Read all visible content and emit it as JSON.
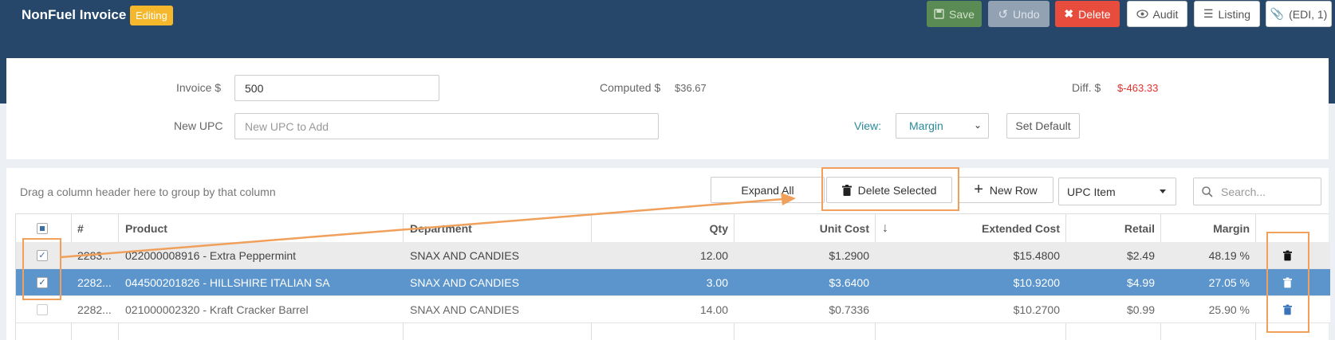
{
  "header": {
    "title": "NonFuel Invoice",
    "badge": "Editing",
    "buttons": {
      "save": "Save",
      "undo": "Undo",
      "delete": "Delete",
      "audit": "Audit",
      "listing": "Listing",
      "edi": "(EDI, 1)"
    }
  },
  "form": {
    "invoice_label": "Invoice $",
    "invoice_value": "500",
    "computed_label": "Computed $",
    "computed_value": "$36.67",
    "diff_label": "Diff. $",
    "diff_value": "$-463.33",
    "new_upc_label": "New UPC",
    "new_upc_placeholder": "New UPC to Add",
    "view_label": "View:",
    "view_value": "Margin",
    "set_default": "Set Default"
  },
  "grid_toolbar": {
    "group_hint": "Drag a column header here to group by that column",
    "expand_all": "Expand All",
    "delete_selected": "Delete Selected",
    "new_row": "New Row",
    "upc_item": "UPC Item",
    "search_placeholder": "Search..."
  },
  "table": {
    "columns": [
      "#",
      "Product",
      "Department",
      "Qty",
      "Unit Cost",
      "Extended Cost",
      "Retail",
      "Margin"
    ],
    "sort_indicator": "↓",
    "rows": [
      {
        "checked": true,
        "num": "2283...",
        "product": "022000008916 - Extra Peppermint",
        "department": "SNAX AND CANDIES",
        "qty": "12.00",
        "unit_cost": "$1.2900",
        "extended_cost": "$15.4800",
        "retail": "$2.49",
        "margin": "48.19 %"
      },
      {
        "checked": true,
        "num": "2282...",
        "product": "044500201826 - HILLSHIRE ITALIAN SA",
        "department": "SNAX AND CANDIES",
        "qty": "3.00",
        "unit_cost": "$3.6400",
        "extended_cost": "$10.9200",
        "retail": "$4.99",
        "margin": "27.05 %"
      },
      {
        "checked": false,
        "num": "2282...",
        "product": "021000002320 - Kraft Cracker Barrel",
        "department": "SNAX AND CANDIES",
        "qty": "14.00",
        "unit_cost": "$0.7336",
        "extended_cost": "$10.2700",
        "retail": "$0.99",
        "margin": "25.90 %"
      }
    ]
  },
  "colors": {
    "header_bg": "#26476a",
    "badge": "#f5b72b",
    "selected_row": "#5b95cc",
    "danger": "#e74c3c",
    "save": "#5b8b55",
    "annotation": "#f0a05a",
    "diff_value": "#e0302a"
  }
}
